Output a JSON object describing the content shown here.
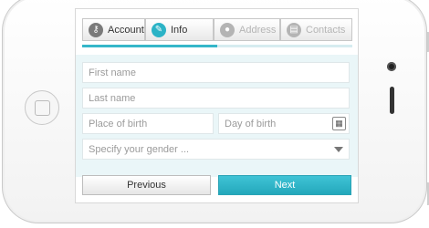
{
  "wizard": {
    "steps": [
      {
        "label": "Account",
        "icon": "key-icon"
      },
      {
        "label": "Info",
        "icon": "pencil-icon"
      },
      {
        "label": "Address",
        "icon": "location-pin-icon"
      },
      {
        "label": "Contacts",
        "icon": "contact-card-icon"
      }
    ],
    "active_step": 1,
    "progress_fraction": 0.5
  },
  "form": {
    "first_name_placeholder": "First name",
    "last_name_placeholder": "Last name",
    "place_of_birth_placeholder": "Place of birth",
    "day_of_birth_placeholder": "Day of birth",
    "gender_placeholder": "Specify your gender ..."
  },
  "buttons": {
    "previous": "Previous",
    "next": "Next"
  },
  "colors": {
    "accent": "#35b6c9",
    "form_bg": "#eaf6f8"
  }
}
